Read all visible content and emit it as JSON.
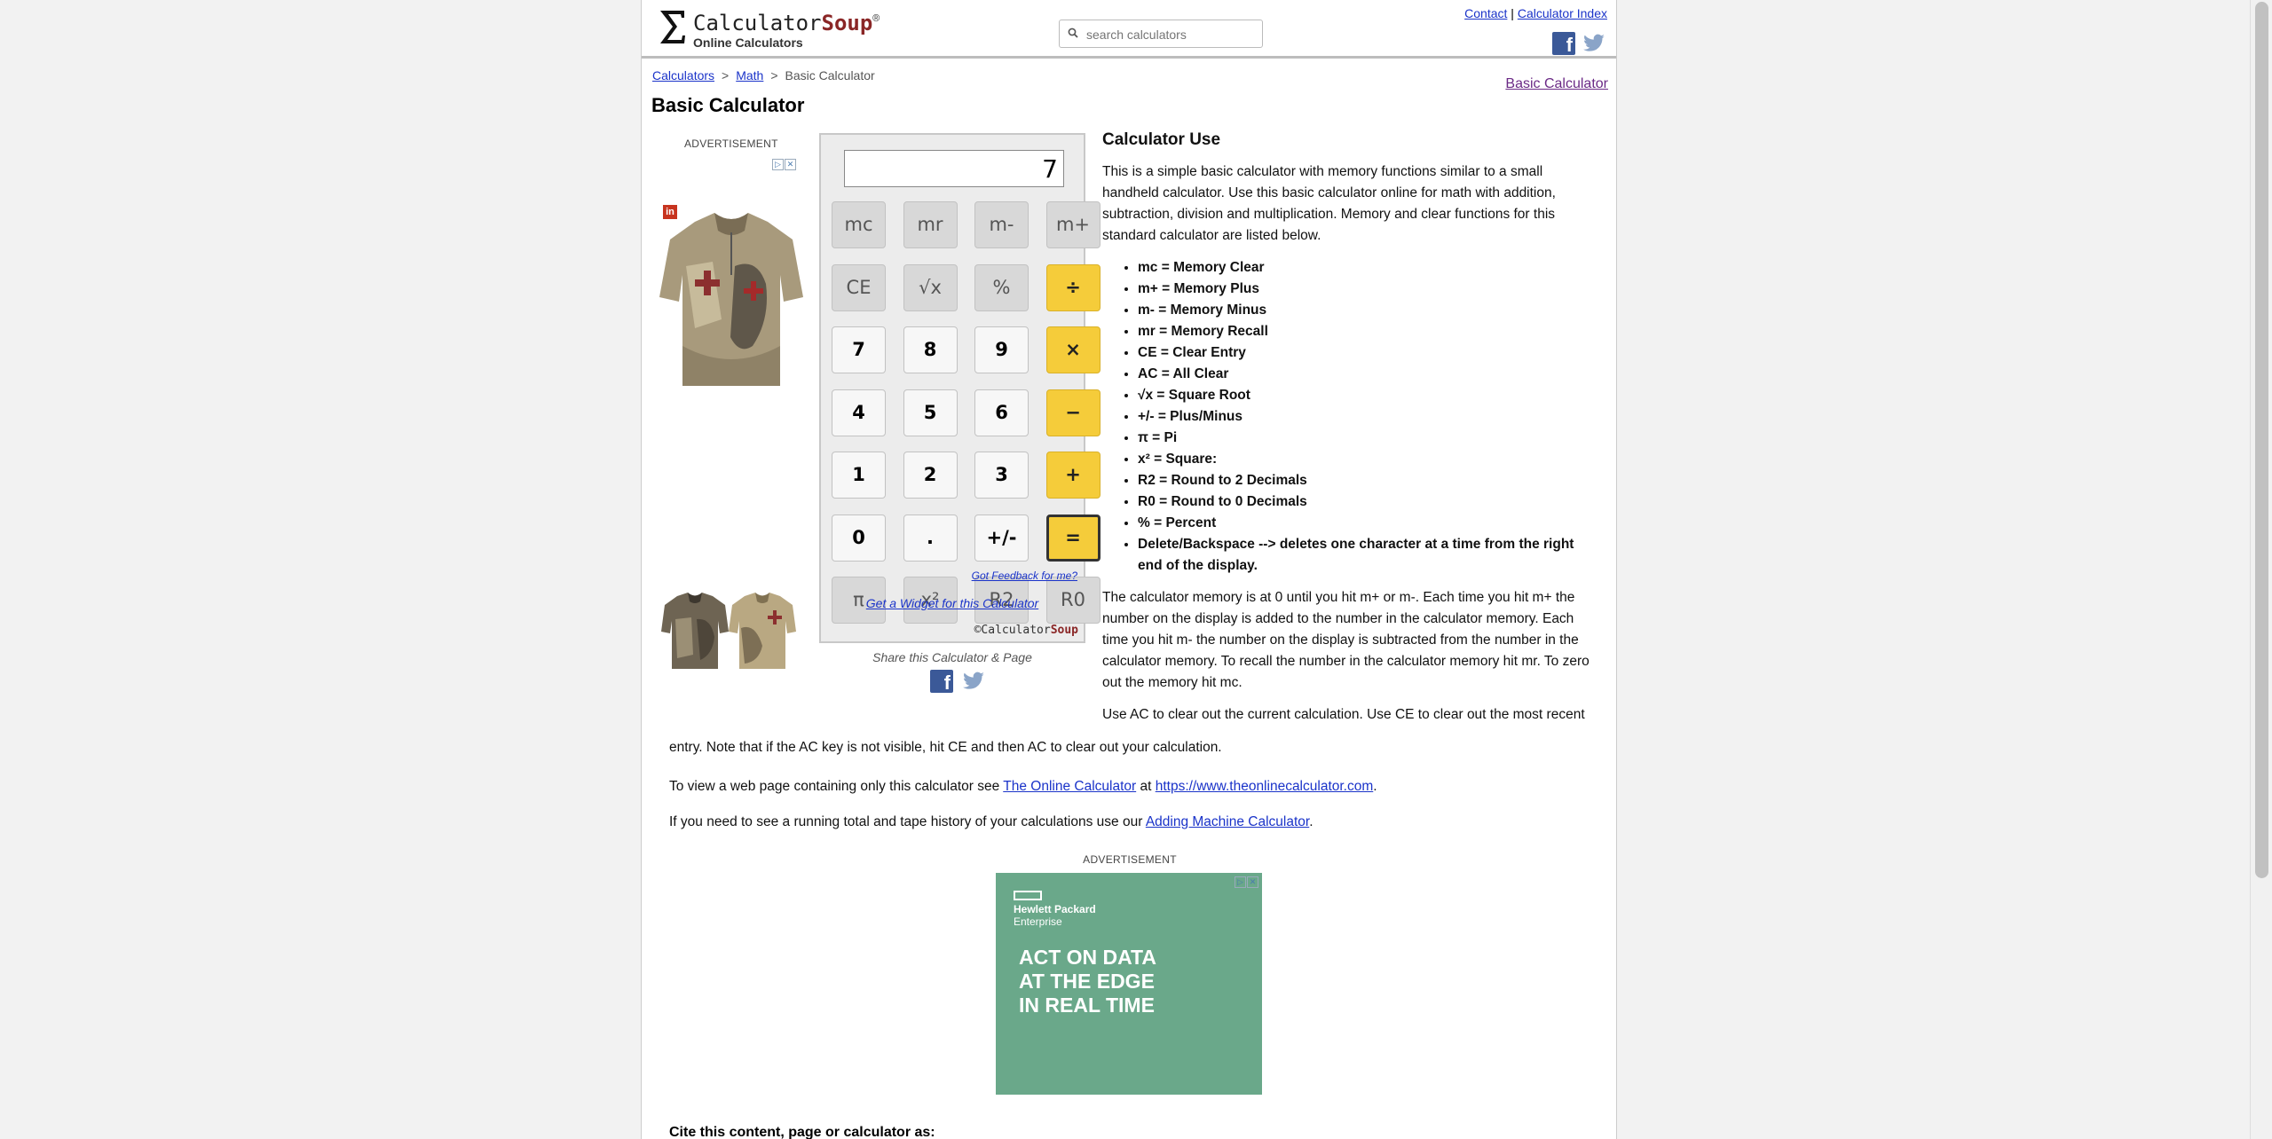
{
  "header": {
    "logo_main": "Calculator",
    "logo_accent": "Soup",
    "logo_reg": "®",
    "logo_sub": "Online Calculators",
    "search_placeholder": "search calculators",
    "contact": "Contact",
    "separator": "|",
    "index": "Calculator Index"
  },
  "breadcrumb": {
    "item1": "Calculators",
    "item2": "Math",
    "current": "Basic Calculator",
    "sep": ">"
  },
  "right_link": "Basic Calculator",
  "page_title": "Basic Calculator",
  "ads": {
    "label": "ADVERTISEMENT",
    "badge": "in",
    "hpe_line1": "Hewlett Packard",
    "hpe_line2": "Enterprise",
    "headline1": "ACT ON DATA",
    "headline2": "AT THE EDGE",
    "headline3": "IN REAL TIME"
  },
  "calculator": {
    "display": "7",
    "keys": [
      [
        "mc",
        "mr",
        "m-",
        "m+"
      ],
      [
        "CE",
        "√x",
        "%",
        "÷"
      ],
      [
        "7",
        "8",
        "9",
        "×"
      ],
      [
        "4",
        "5",
        "6",
        "−"
      ],
      [
        "1",
        "2",
        "3",
        "+"
      ],
      [
        "0",
        ".",
        "+/-",
        "="
      ],
      [
        "π",
        "x²",
        "R2",
        "R0"
      ]
    ],
    "feedback": "Got Feedback for me?",
    "widget": "Get a Widget for this Calculator",
    "copyright_prefix": "©Calculator",
    "copyright_accent": "Soup"
  },
  "share": {
    "label": "Share this Calculator & Page"
  },
  "content": {
    "heading": "Calculator Use",
    "intro": "This is a simple basic calculator with memory functions similar to a small handheld calculator. Use this basic calculator online for math with addition, subtraction, division and multiplication. Memory and clear functions for this standard calculator are listed below.",
    "list": [
      "mc = Memory Clear",
      "m+ = Memory Plus",
      "m- = Memory Minus",
      "mr = Memory Recall",
      "CE = Clear Entry",
      "AC = All Clear",
      "√x = Square Root",
      "+/- = Plus/Minus",
      "π = Pi",
      "x² = Square:",
      "R2 = Round to 2 Decimals",
      "R0 = Round to 0 Decimals",
      "% = Percent",
      "Delete/Backspace --> deletes one character at a time from the right end of the display."
    ],
    "memory_para": "The calculator memory is at 0 until you hit m+ or m-. Each time you hit m+ the number on the display is added to the number in the calculator memory. Each time you hit m- the number on the display is subtracted from the number in the calculator memory. To recall the number in the calculator memory hit mr. To zero out the memory hit mc.",
    "clear_para_a": "Use AC to clear out the current calculation. Use CE to clear out the most recent",
    "clear_para_b": "entry. Note that if the AC key is not visible, hit CE and then AC to clear out your calculation.",
    "view_prefix": "To view a web page containing only this calculator see ",
    "view_link1": "The Online Calculator",
    "view_mid": " at ",
    "view_link2": "https://www.theonlinecalculator.com",
    "view_suffix": ".",
    "tape_prefix": "If you need to see a running total and tape history of your calculations use our ",
    "tape_link": "Adding Machine Calculator",
    "tape_suffix": ".",
    "cite": "Cite this content, page or calculator as:"
  },
  "colors": {
    "accent_yellow": "#f5cc3a",
    "link_blue": "#1a33c9",
    "logo_red": "#8a2626",
    "ad_green": "#6aa88a"
  }
}
